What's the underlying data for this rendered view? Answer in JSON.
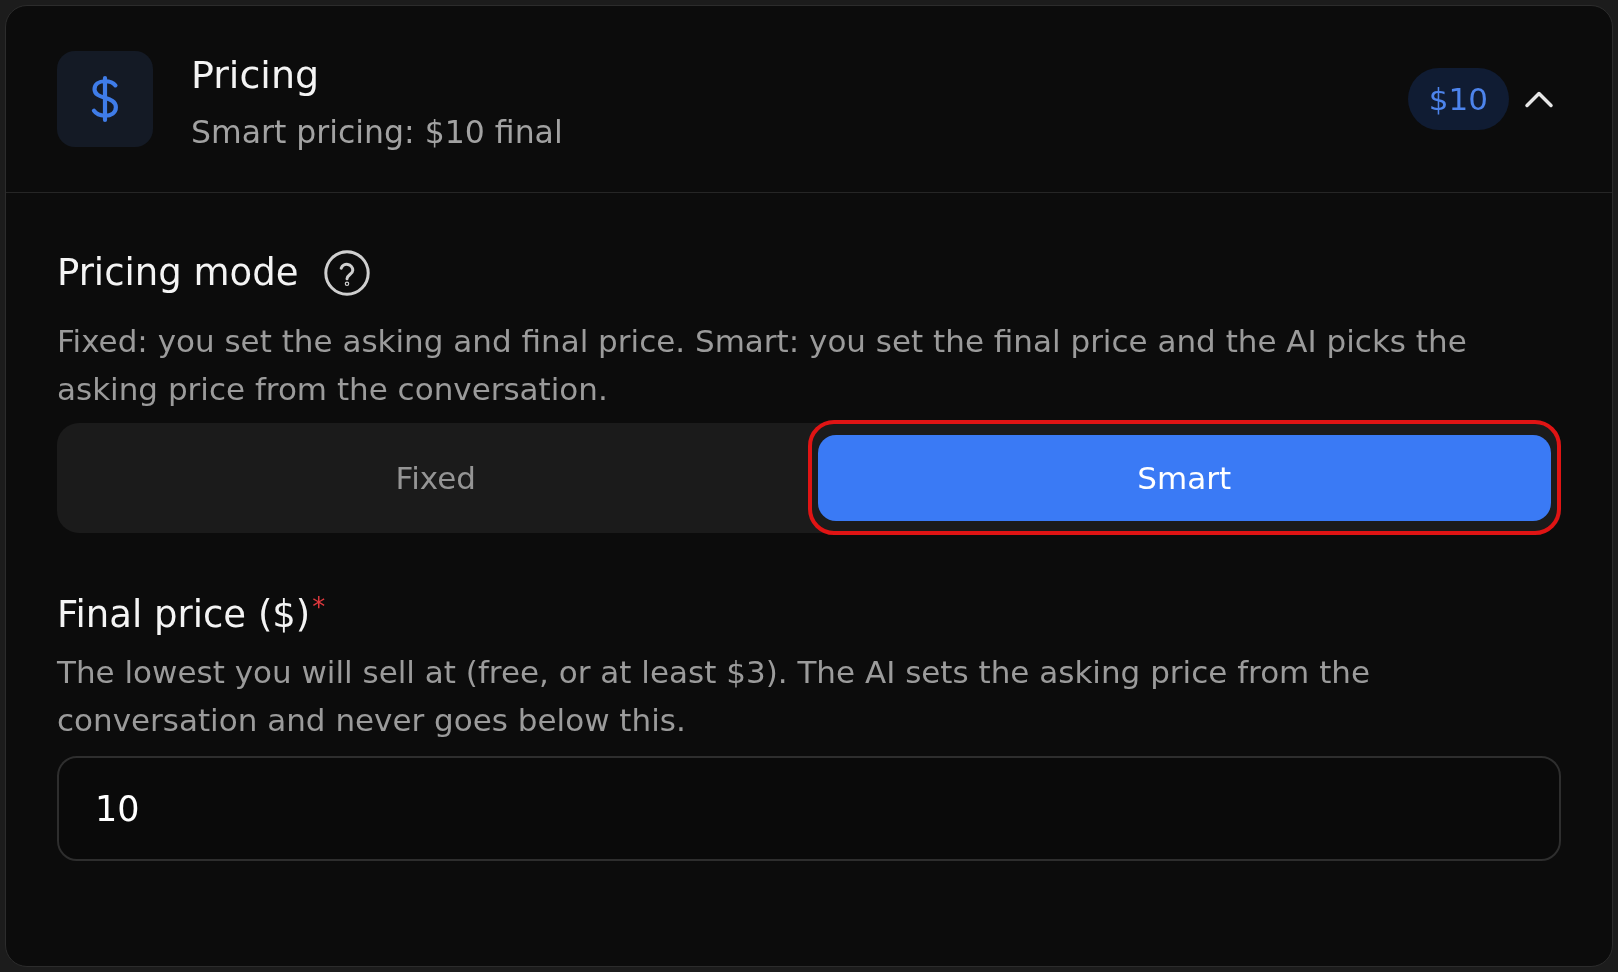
{
  "section": {
    "title": "Pricing",
    "subtitle": "Smart pricing: $10 final",
    "badge": "$10",
    "expanded": true
  },
  "pricing_mode": {
    "label": "Pricing mode",
    "description": "Fixed: you set the asking and final price. Smart: you set the final price and the AI picks the asking price from the conversation.",
    "options": [
      {
        "label": "Fixed",
        "selected": false,
        "highlighted": false
      },
      {
        "label": "Smart",
        "selected": true,
        "highlighted": true
      }
    ]
  },
  "final_price": {
    "label": "Final price ($)",
    "required_mark": "*",
    "description": "The lowest you will sell at (free, or at least $3). The AI sets the asking price from the conversation and never goes below this.",
    "value": "10"
  }
}
